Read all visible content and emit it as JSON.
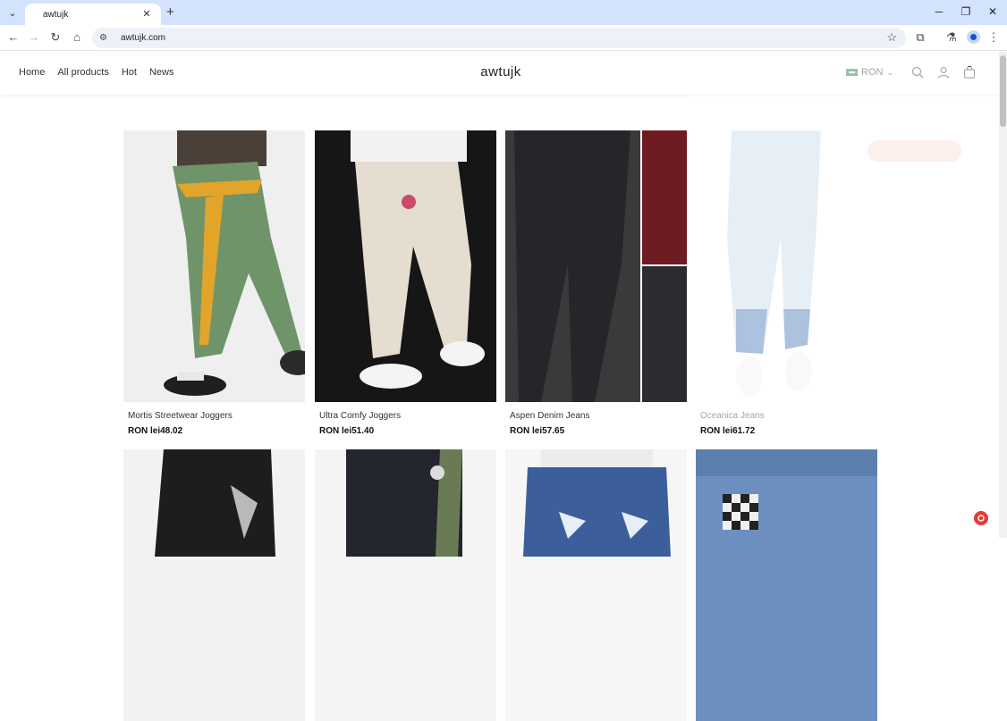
{
  "browser": {
    "tab_title": "awtujk",
    "url": "awtujk.com"
  },
  "site": {
    "nav": [
      "Home",
      "All products",
      "Hot",
      "News"
    ],
    "logo": "awtujk",
    "currency": "RON"
  },
  "products": [
    {
      "name": "Mortis Streetwear Joggers",
      "price": "RON lei48.02",
      "colors": [
        "#7a9a73",
        "#e2a52a",
        "#1f1f1f"
      ]
    },
    {
      "name": "Ultra Comfy Joggers",
      "price": "RON lei51.40",
      "colors": [
        "#e6dfd2",
        "#1a1a1a"
      ]
    },
    {
      "name": "Aspen Denim Jeans",
      "price": "RON lei57.65",
      "colors": [
        "#2b2b2e",
        "#7a1f25"
      ]
    },
    {
      "name": "Oceanica Jeans",
      "price": "RON lei61.72",
      "colors": [
        "#bcd3e6",
        "#3f6fb3"
      ]
    },
    {
      "name": "",
      "price": "",
      "colors": [
        "#1a1a1a"
      ]
    },
    {
      "name": "",
      "price": "",
      "colors": [
        "#23262c",
        "#6a7a55"
      ]
    },
    {
      "name": "",
      "price": "",
      "colors": [
        "#3c5f9b",
        "#f0f0f0"
      ]
    },
    {
      "name": "",
      "price": "",
      "colors": [
        "#6d8fc0",
        "#222"
      ]
    }
  ],
  "colors": {
    "tab_strip": "#d3e3fd",
    "help_bubble": "#e53935"
  }
}
